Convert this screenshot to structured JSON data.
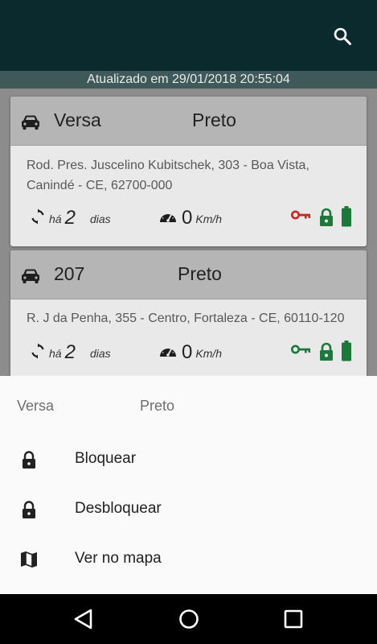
{
  "header": {
    "search_icon": "search-icon",
    "updated_text": "Atualizado em 29/01/2018 20:55:04"
  },
  "vehicles": [
    {
      "model": "Versa",
      "color": "Preto",
      "address_line1": "Rod. Pres. Juscelino Kubitschek, 303 - Boa Vista,",
      "address_line2": "Canindé - CE, 62700-000",
      "ha_label": "há",
      "time_value": "2",
      "time_unit": "dias",
      "speed_value": "0",
      "speed_unit": "Km/h",
      "ignition": "off",
      "ignition_color": "#c62828",
      "lock_color": "#1b7a3a",
      "battery_color": "#1b7a3a"
    },
    {
      "model": "207",
      "color": "Preto",
      "address_line1": "R. J da Penha, 355 - Centro, Fortaleza - CE, 60110-120",
      "ha_label": "há",
      "time_value": "2",
      "time_unit": "dias",
      "speed_value": "0",
      "speed_unit": "Km/h",
      "ignition": "on",
      "ignition_color": "#1b7a3a",
      "lock_color": "#1b7a3a",
      "battery_color": "#1b7a3a"
    }
  ],
  "sheet": {
    "title_model": "Versa",
    "title_color": "Preto",
    "items": [
      {
        "label": "Bloquear",
        "icon": "lock-icon"
      },
      {
        "label": "Desbloquear",
        "icon": "lock-icon"
      },
      {
        "label": "Ver no mapa",
        "icon": "map-icon"
      }
    ]
  },
  "navbar": {
    "back_icon": "back-triangle-icon",
    "home_icon": "home-circle-icon",
    "recents_icon": "recents-square-icon"
  }
}
